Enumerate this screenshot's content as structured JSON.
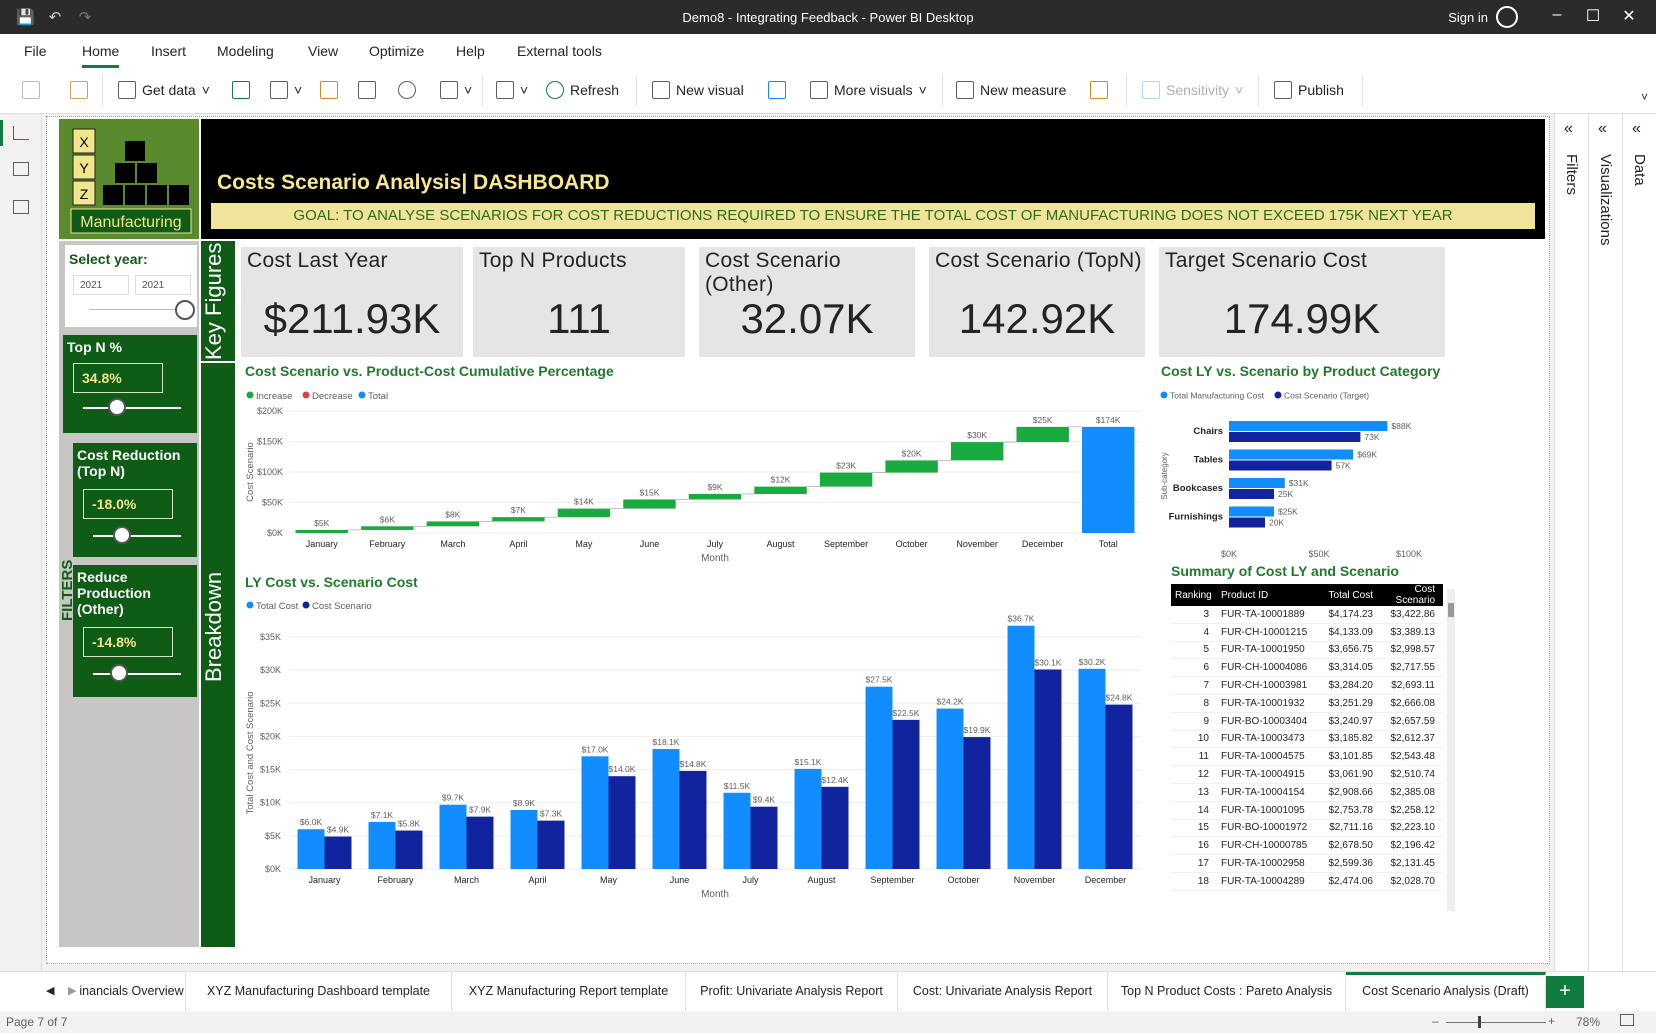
{
  "titlebar": {
    "title": "Demo8 - Integrating Feedback - Power BI Desktop",
    "signin": "Sign in"
  },
  "menu": [
    "File",
    "Home",
    "Insert",
    "Modeling",
    "View",
    "Optimize",
    "Help",
    "External tools"
  ],
  "ribbon": {
    "get_data": "Get data",
    "refresh": "Refresh",
    "new_visual": "New visual",
    "more_visuals": "More visuals",
    "new_measure": "New measure",
    "sensitivity": "Sensitivity",
    "publish": "Publish"
  },
  "panes": {
    "filters": "Filters",
    "visualizations": "Visualizations",
    "data": "Data"
  },
  "logo": {
    "letters": [
      "X",
      "Y",
      "Z"
    ],
    "caption": "Manufacturing"
  },
  "report": {
    "title": "Costs Scenario Analysis| DASHBOARD",
    "goal": "GOAL: TO ANALYSE SCENARIOS FOR COST REDUCTIONS REQUIRED TO ENSURE THE TOTAL COST OF MANUFACTURING DOES NOT EXCEED 175K NEXT YEAR",
    "filters_label": "FILTERS",
    "key_figures_label": "Key Figures",
    "breakdown_label": "Breakdown"
  },
  "slicers": {
    "year_title": "Select year:",
    "year_from": "2021",
    "year_to": "2021",
    "topn_title": "Top N %",
    "topn_value": "34.8%",
    "topn_level": 0.35,
    "costred_title": "Cost Reduction (Top N)",
    "costred_value": "-18.0%",
    "costred_level": 0.33,
    "reduceprod_title": "Reduce Production (Other)",
    "reduceprod_value": "-14.8%",
    "reduceprod_level": 0.3
  },
  "kpis": [
    {
      "title": "Cost Last Year",
      "value": "$211.93K"
    },
    {
      "title": "Top N Products",
      "value": "111"
    },
    {
      "title": "Cost Scenario (Other)",
      "value": "32.07K"
    },
    {
      "title": "Cost Scenario (TopN)",
      "value": "142.92K"
    },
    {
      "title": "Target Scenario Cost",
      "value": "174.99K"
    }
  ],
  "chart_data": [
    {
      "type": "waterfall",
      "title": "Cost Scenario vs. Product-Cost Cumulative Percentage",
      "legend": [
        "Increase",
        "Decrease",
        "Total"
      ],
      "colors": {
        "increase": "#1aab40",
        "decrease": "#d64550",
        "total": "#118dff"
      },
      "xlabel": "Month",
      "ylabel": "Cost Scenario",
      "yticks": [
        "$0K",
        "$50K",
        "$100K",
        "$150K",
        "$200K"
      ],
      "ylim": [
        0,
        200
      ],
      "categories": [
        "January",
        "February",
        "March",
        "April",
        "May",
        "June",
        "July",
        "August",
        "September",
        "October",
        "November",
        "December",
        "Total"
      ],
      "values": [
        5,
        6,
        8,
        7,
        14,
        15,
        9,
        12,
        23,
        20,
        30,
        25,
        174
      ],
      "labels": [
        "$5K",
        "$6K",
        "$8K",
        "$7K",
        "$14K",
        "$15K",
        "$9K",
        "$12K",
        "$23K",
        "$20K",
        "$30K",
        "$25K",
        "$174K"
      ]
    },
    {
      "type": "bar",
      "title": "Cost LY vs. Scenario by Product Category",
      "series": [
        {
          "name": "Total Manufacturing Cost",
          "color": "#118dff",
          "values": [
            88,
            69,
            31,
            25
          ],
          "labels": [
            "$88K",
            "$69K",
            "$31K",
            "$25K"
          ]
        },
        {
          "name": "Cost Scenario (Target)",
          "color": "#12239e",
          "values": [
            73,
            57,
            25,
            20
          ],
          "labels": [
            "73K",
            "57K",
            "25K",
            "20K"
          ]
        }
      ],
      "categories": [
        "Chairs",
        "Tables",
        "Bookcases",
        "Furnishings"
      ],
      "ylabel": "Sub-category",
      "xticks": [
        "$0K",
        "$50K",
        "$100K"
      ],
      "xlim": [
        0,
        100
      ]
    },
    {
      "type": "bar",
      "title": "LY Cost vs. Scenario Cost",
      "xlabel": "Month",
      "ylabel": "Total Cost and Cost Scenario",
      "yticks": [
        "$0K",
        "$5K",
        "$10K",
        "$15K",
        "$20K",
        "$25K",
        "$30K",
        "$35K"
      ],
      "ylim": [
        0,
        35
      ],
      "categories": [
        "January",
        "February",
        "March",
        "April",
        "May",
        "June",
        "July",
        "August",
        "September",
        "October",
        "November",
        "December"
      ],
      "series": [
        {
          "name": "Total Cost",
          "color": "#118dff",
          "values": [
            6.0,
            7.1,
            9.7,
            8.9,
            17.0,
            18.1,
            11.5,
            15.1,
            27.5,
            24.2,
            36.7,
            30.2
          ],
          "labels": [
            "$6.0K",
            "$7.1K",
            "$9.7K",
            "$8.9K",
            "$17.0K",
            "$18.1K",
            "$11.5K",
            "$15.1K",
            "$27.5K",
            "$24.2K",
            "$36.7K",
            "$30.2K"
          ]
        },
        {
          "name": "Cost Scenario",
          "color": "#12239e",
          "values": [
            4.9,
            5.8,
            7.9,
            7.3,
            14.0,
            14.8,
            9.4,
            12.4,
            22.5,
            19.9,
            30.1,
            24.8
          ],
          "labels": [
            "$4.9K",
            "$5.8K",
            "$7.9K",
            "$7.3K",
            "$14.0K",
            "$14.8K",
            "$9.4K",
            "$12.4K",
            "$22.5K",
            "$19.9K",
            "$30.1K",
            "$24.8K"
          ]
        }
      ]
    },
    {
      "type": "table",
      "title": "Summary of Cost LY and Scenario",
      "columns": [
        "Ranking",
        "Product ID",
        "Total Cost",
        "Cost Scenario"
      ],
      "rows": [
        [
          "3",
          "FUR-TA-10001889",
          "$4,174.23",
          "$3,422.86"
        ],
        [
          "4",
          "FUR-CH-10001215",
          "$4,133.09",
          "$3,389.13"
        ],
        [
          "5",
          "FUR-TA-10001950",
          "$3,656.75",
          "$2,998.57"
        ],
        [
          "6",
          "FUR-CH-10004086",
          "$3,314.05",
          "$2,717.55"
        ],
        [
          "7",
          "FUR-CH-10003981",
          "$3,284.20",
          "$2,693.11"
        ],
        [
          "8",
          "FUR-TA-10001932",
          "$3,251.29",
          "$2,666.08"
        ],
        [
          "9",
          "FUR-BO-10003404",
          "$3,240.97",
          "$2,657.59"
        ],
        [
          "10",
          "FUR-TA-10003473",
          "$3,185.82",
          "$2,612.37"
        ],
        [
          "11",
          "FUR-TA-10004575",
          "$3,101.85",
          "$2,543.48"
        ],
        [
          "12",
          "FUR-TA-10004915",
          "$3,061.90",
          "$2,510.74"
        ],
        [
          "13",
          "FUR-TA-10004154",
          "$2,908.66",
          "$2,385.08"
        ],
        [
          "14",
          "FUR-TA-10001095",
          "$2,753.78",
          "$2,258.12"
        ],
        [
          "15",
          "FUR-BO-10001972",
          "$2,711.16",
          "$2,223.10"
        ],
        [
          "16",
          "FUR-CH-10000785",
          "$2,678.50",
          "$2,196.42"
        ],
        [
          "17",
          "FUR-TA-10002958",
          "$2,599.36",
          "$2,131.45"
        ],
        [
          "18",
          "FUR-TA-10004289",
          "$2,474.06",
          "$2,028.70"
        ]
      ]
    }
  ],
  "tabs": [
    "inancials Overview",
    "XYZ Manufacturing Dashboard template",
    "XYZ Manufacturing Report template",
    "Profit: Univariate Analysis Report",
    "Cost: Univariate Analysis Report",
    "Top N Product Costs : Pareto Analysis",
    "Cost Scenario Analysis (Draft)"
  ],
  "status": {
    "page": "Page 7 of 7",
    "zoom": "78%"
  }
}
